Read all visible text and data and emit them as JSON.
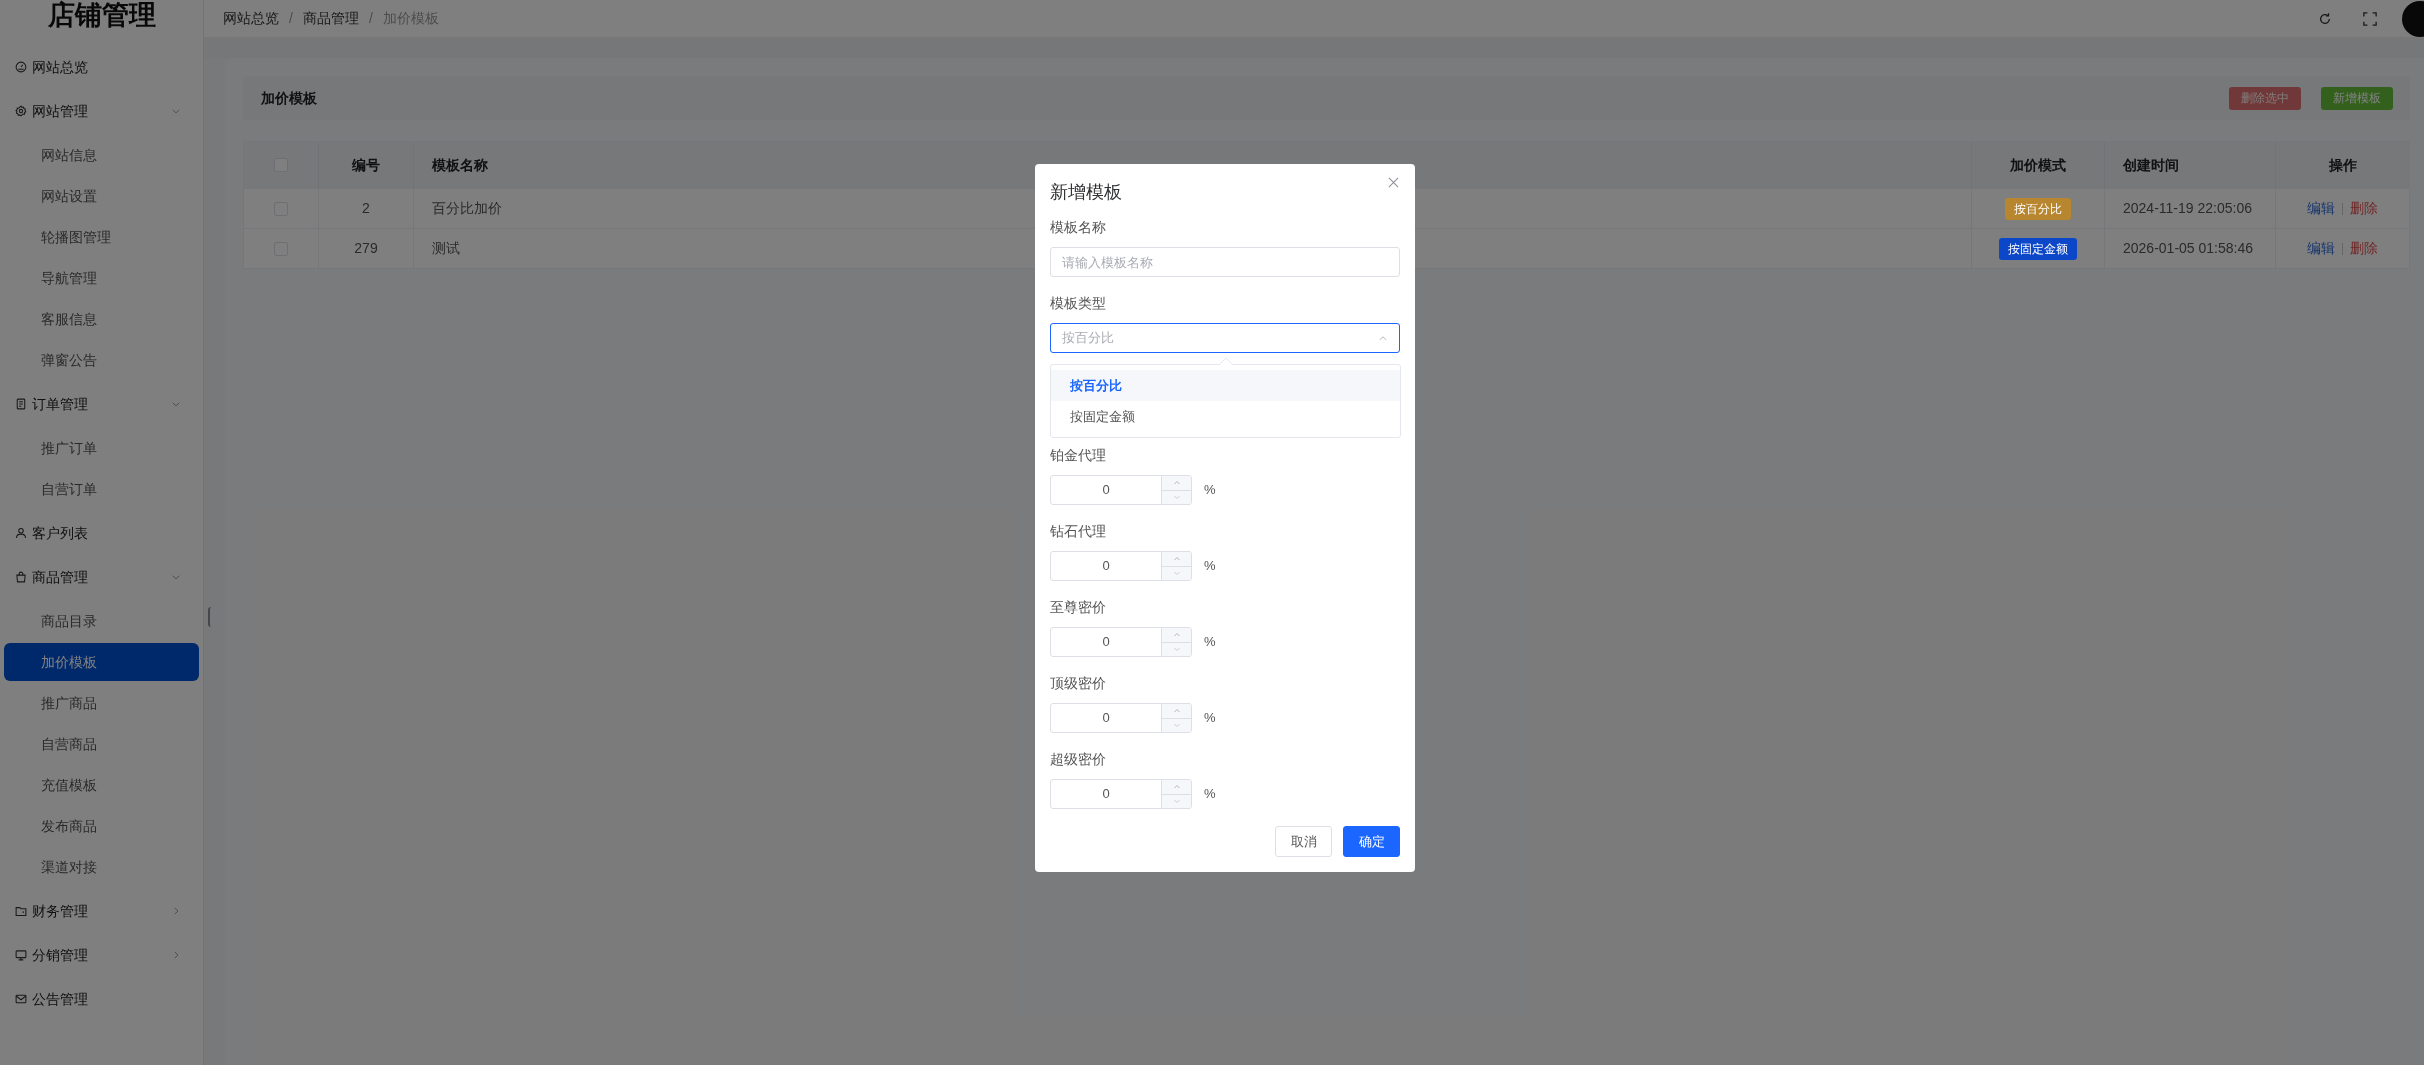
{
  "sidebar": {
    "title": "店铺管理",
    "items": [
      {
        "label": "网站总览",
        "kind": "link",
        "selected": false
      },
      {
        "label": "网站管理",
        "kind": "group",
        "expanded": true,
        "selected": false,
        "children": [
          {
            "label": "网站信息",
            "selected": false
          },
          {
            "label": "网站设置",
            "selected": false
          },
          {
            "label": "轮播图管理",
            "selected": false
          },
          {
            "label": "导航管理",
            "selected": false
          },
          {
            "label": "客服信息",
            "selected": false
          },
          {
            "label": "弹窗公告",
            "selected": false
          }
        ]
      },
      {
        "label": "订单管理",
        "kind": "group",
        "expanded": true,
        "selected": false,
        "children": [
          {
            "label": "推广订单",
            "selected": false
          },
          {
            "label": "自营订单",
            "selected": false
          }
        ]
      },
      {
        "label": "客户列表",
        "kind": "link",
        "selected": false
      },
      {
        "label": "商品管理",
        "kind": "group",
        "expanded": true,
        "selected": false,
        "children": [
          {
            "label": "商品目录",
            "selected": false
          },
          {
            "label": "加价模板",
            "selected": true
          },
          {
            "label": "推广商品",
            "selected": false
          },
          {
            "label": "自营商品",
            "selected": false
          },
          {
            "label": "充值模板",
            "selected": false
          },
          {
            "label": "发布商品",
            "selected": false
          },
          {
            "label": "渠道对接",
            "selected": false
          }
        ]
      },
      {
        "label": "财务管理",
        "kind": "group",
        "expanded": false,
        "selected": false
      },
      {
        "label": "分销管理",
        "kind": "group",
        "expanded": false,
        "selected": false
      },
      {
        "label": "公告管理",
        "kind": "link",
        "selected": false
      }
    ]
  },
  "header": {
    "breadcrumb": [
      "网站总览",
      "商品管理",
      "加价模板"
    ],
    "separator": "/"
  },
  "card": {
    "title": "加价模板",
    "buttons": [
      {
        "label": "删除选中",
        "kind": "danger",
        "disabled": true
      },
      {
        "label": "新增模板",
        "kind": "success",
        "disabled": false
      }
    ]
  },
  "table": {
    "all_checked": false,
    "columns": [
      "编号",
      "模板名称",
      "加价模式",
      "创建时间",
      "操作"
    ],
    "rows": [
      {
        "checked": false,
        "id": "2",
        "name": "百分比加价",
        "mode": {
          "label": "按百分比",
          "color": "#b8862e"
        },
        "created": "2024-11-19 22:05:06",
        "actions": [
          "编辑",
          "删除"
        ]
      },
      {
        "checked": false,
        "id": "279",
        "name": "测试",
        "mode": {
          "label": "按固定金额",
          "color": "#0d47c9"
        },
        "created": "2026-01-05 01:58:46",
        "actions": [
          "编辑",
          "删除"
        ]
      }
    ]
  },
  "modal": {
    "title": "新增模板",
    "fields": [
      {
        "kind": "text",
        "label": "模板名称",
        "placeholder": "请输入模板名称"
      },
      {
        "kind": "select",
        "label": "模板类型",
        "placeholder": "按百分比",
        "open": true,
        "options": [
          {
            "label": "按百分比",
            "selected": true
          },
          {
            "label": "按固定金额",
            "selected": false
          }
        ]
      },
      {
        "kind": "number",
        "label": "铂金代理",
        "value": "0",
        "unit": "%"
      },
      {
        "kind": "number",
        "label": "钻石代理",
        "value": "0",
        "unit": "%"
      },
      {
        "kind": "number",
        "label": "至尊密价",
        "value": "0",
        "unit": "%"
      },
      {
        "kind": "number",
        "label": "顶级密价",
        "value": "0",
        "unit": "%"
      },
      {
        "kind": "number",
        "label": "超级密价",
        "value": "0",
        "unit": "%"
      }
    ],
    "buttons": [
      {
        "label": "取消",
        "kind": "default"
      },
      {
        "label": "确定",
        "kind": "primary"
      }
    ]
  }
}
